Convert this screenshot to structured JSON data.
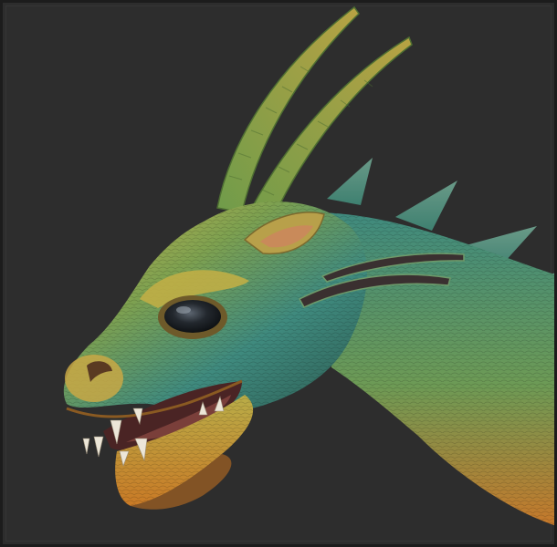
{
  "scene": {
    "subject": "dragon-head-sculpt",
    "background_color": "#2d2d2d",
    "frame_color": "#1c1c1c"
  },
  "palette": {
    "skin_light": "#c8b04a",
    "skin_mid": "#6f9a4e",
    "skin_teal": "#3f8a7e",
    "skin_dark": "#2c5a4e",
    "belly_orange": "#c7782a",
    "mouth_inner": "#5a2a2a",
    "tongue": "#7a3f3a",
    "teeth": "#ece6d8",
    "eye": "#1a1e22",
    "horn": "#8fa043"
  }
}
